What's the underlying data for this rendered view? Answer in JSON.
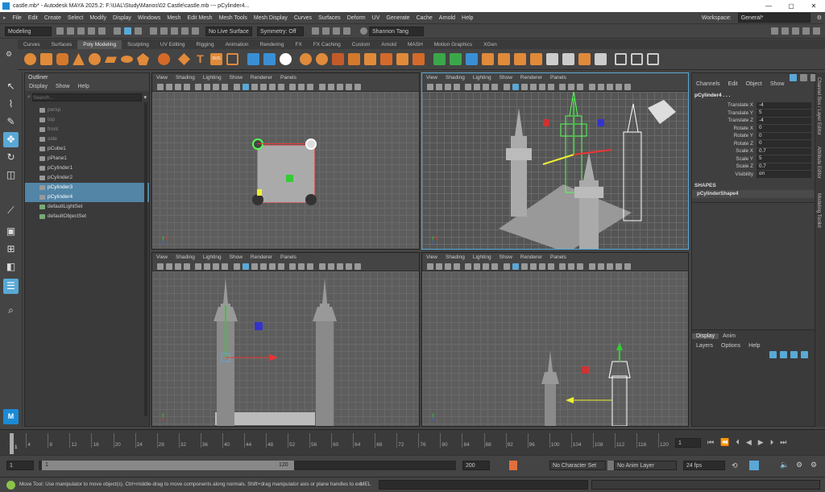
{
  "app": {
    "title": "castle.mb* - Autodesk MAYA 2025.2: F:\\UAL\\Study\\Manos\\02 Castle\\castle.mb    ---    pCylinder4...",
    "min": "—",
    "max": "▢",
    "close": "✕"
  },
  "menus": [
    "File",
    "Edit",
    "Create",
    "Select",
    "Modify",
    "Display",
    "Windows",
    "Mesh",
    "Edit Mesh",
    "Mesh Tools",
    "Mesh Display",
    "Curves",
    "Surfaces",
    "Deform",
    "UV",
    "Generate",
    "Cache",
    "Arnold",
    "Help"
  ],
  "workspace": {
    "label": "Workspace:",
    "value": "General*"
  },
  "statusline": {
    "menuset": "Modeling",
    "live_surface": "No Live Surface",
    "symmetry": "Symmetry: Off",
    "user": "Shannon Tang"
  },
  "shelf_tabs": [
    "Curves",
    "Surfaces",
    "Poly Modeling",
    "Sculpting",
    "UV Editing",
    "Rigging",
    "Animation",
    "Rendering",
    "FX",
    "FX Caching",
    "Custom",
    "Arnold",
    "MASH",
    "Motion Graphics",
    "XGen"
  ],
  "shelf_active_tab": "Poly Modeling",
  "outliner": {
    "title": "Outliner",
    "menu": [
      "Display",
      "Show",
      "Help"
    ],
    "search_placeholder": "Search...",
    "items": [
      {
        "label": "persp",
        "type": "camera"
      },
      {
        "label": "top",
        "type": "camera"
      },
      {
        "label": "front",
        "type": "camera"
      },
      {
        "label": "side",
        "type": "camera"
      },
      {
        "label": "pCube1",
        "type": "mesh"
      },
      {
        "label": "pPlane1",
        "type": "mesh"
      },
      {
        "label": "pCylinder1",
        "type": "mesh"
      },
      {
        "label": "pCylinder2",
        "type": "mesh"
      },
      {
        "label": "pCylinder3",
        "type": "mesh",
        "selected": true
      },
      {
        "label": "pCylinder4",
        "type": "mesh",
        "selected": true
      },
      {
        "label": "defaultLightSet",
        "type": "set"
      },
      {
        "label": "defaultObjectSet",
        "type": "set"
      }
    ]
  },
  "viewport_menu": [
    "View",
    "Shading",
    "Lighting",
    "Show",
    "Renderer",
    "Panels"
  ],
  "axis_labels": {
    "x": "x",
    "y": "y",
    "z": "z"
  },
  "channelbox": {
    "tabs": [
      "Channels",
      "Edit",
      "Object",
      "Show"
    ],
    "object": "pCylinder4 . . .",
    "attrs": [
      {
        "label": "Translate X",
        "value": "-4"
      },
      {
        "label": "Translate Y",
        "value": "5"
      },
      {
        "label": "Translate Z",
        "value": "-4"
      },
      {
        "label": "Rotate X",
        "value": "0"
      },
      {
        "label": "Rotate Y",
        "value": "0"
      },
      {
        "label": "Rotate Z",
        "value": "0"
      },
      {
        "label": "Scale X",
        "value": "0.7"
      },
      {
        "label": "Scale Y",
        "value": "5"
      },
      {
        "label": "Scale Z",
        "value": "0.7"
      },
      {
        "label": "Visibility",
        "value": "on"
      }
    ],
    "shapes_label": "SHAPES",
    "shape": "pCylinderShape4"
  },
  "layer_editor": {
    "tabs": [
      "Display",
      "Anim"
    ],
    "menu": [
      "Layers",
      "Options",
      "Help"
    ]
  },
  "side_tabs": [
    "Channel Box / Layer Editor",
    "Attribute Editor",
    "Modeling Toolkit"
  ],
  "timeline": {
    "ticks": [
      "1",
      "4",
      "8",
      "12",
      "16",
      "20",
      "24",
      "28",
      "32",
      "36",
      "40",
      "44",
      "48",
      "52",
      "56",
      "60",
      "64",
      "68",
      "72",
      "76",
      "80",
      "84",
      "88",
      "92",
      "96",
      "100",
      "104",
      "108",
      "112",
      "116",
      "120"
    ],
    "current_frame": "1",
    "current_frame_field": "1"
  },
  "range": {
    "start": "1",
    "inner_start": "1",
    "inner_end": "120",
    "end": "200",
    "character_set": "No Character Set",
    "anim_layer": "No Anim Layer",
    "fps": "24 fps"
  },
  "helpline": {
    "text": "Move Tool: Use manipulator to move object(s). Ctrl+middle-drag to move components along normals. Shift+drag manipulator axis or plane handles to ext",
    "mel": "MEL"
  },
  "colors": {
    "selection": "#5285a6",
    "bg": "#444444",
    "viewport": "#5d5d5d",
    "accent": "#5aa8d6"
  }
}
